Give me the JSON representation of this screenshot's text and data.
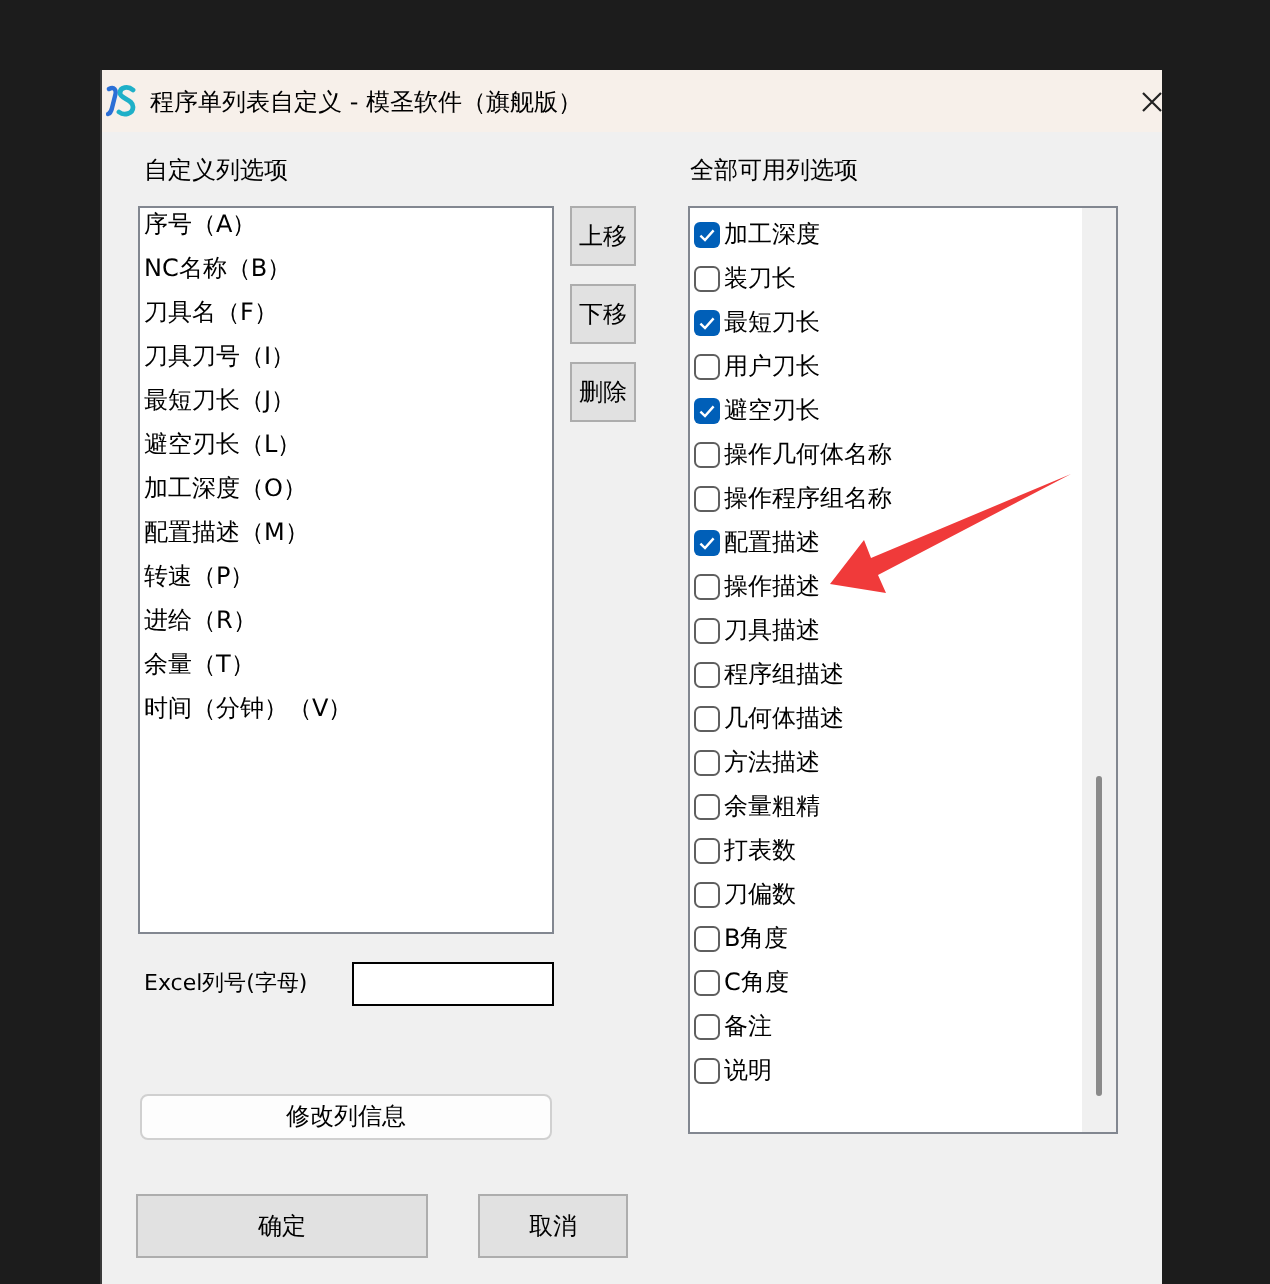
{
  "window": {
    "title": "程序单列表自定义 - 模圣软件（旗舰版）"
  },
  "custom_columns": {
    "label": "自定义列选项",
    "items": [
      {
        "label": "序号（A）",
        "selected": false
      },
      {
        "label": "NC名称（B）",
        "selected": false
      },
      {
        "label": "刀具名（F）",
        "selected": false
      },
      {
        "label": "刀具刀号（I）",
        "selected": false
      },
      {
        "label": "最短刀长（J）",
        "selected": false
      },
      {
        "label": "避空刃长（L）",
        "selected": false
      },
      {
        "label": "加工深度（O）",
        "selected": false
      },
      {
        "label": "配置描述（M）",
        "selected": false
      },
      {
        "label": "转速（P）",
        "selected": false
      },
      {
        "label": "进给（R）",
        "selected": false
      },
      {
        "label": "余量（T）",
        "selected": false
      },
      {
        "label": "时间（分钟）（V）",
        "selected": false
      }
    ]
  },
  "list_buttons": [
    "上移",
    "下移",
    "删除"
  ],
  "available_columns": {
    "label": "全部可用列选项",
    "items": [
      {
        "label": "加工深度",
        "checked": true
      },
      {
        "label": "装刀长",
        "checked": false
      },
      {
        "label": "最短刀长",
        "checked": true
      },
      {
        "label": "用户刀长",
        "checked": false
      },
      {
        "label": "避空刃长",
        "checked": true
      },
      {
        "label": "操作几何体名称",
        "checked": false
      },
      {
        "label": "操作程序组名称",
        "checked": false
      },
      {
        "label": "配置描述",
        "checked": true
      },
      {
        "label": "操作描述",
        "checked": false
      },
      {
        "label": "刀具描述",
        "checked": false
      },
      {
        "label": "程序组描述",
        "checked": false
      },
      {
        "label": "几何体描述",
        "checked": false
      },
      {
        "label": "方法描述",
        "checked": false
      },
      {
        "label": "余量粗精",
        "checked": false
      },
      {
        "label": "打表数",
        "checked": false
      },
      {
        "label": "刀偏数",
        "checked": false
      },
      {
        "label": "B角度",
        "checked": false
      },
      {
        "label": "C角度",
        "checked": false
      },
      {
        "label": "备注",
        "checked": false
      },
      {
        "label": "说明",
        "checked": false
      }
    ]
  },
  "excel_column": {
    "label": "Excel列号(字母)"
  },
  "modify_button": "修改列信息",
  "dialog_buttons": [
    "确定",
    "取消"
  ],
  "annotations": [
    {
      "kind": "arrow"
    }
  ]
}
